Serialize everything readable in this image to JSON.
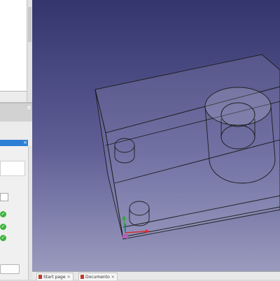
{
  "task_panel": {
    "close_glyph": "×",
    "checks": [
      "✓",
      "✓",
      "✓"
    ]
  },
  "tabs": [
    {
      "label": "Start page",
      "close": "×",
      "icon": "freecad-document-icon"
    },
    {
      "label": "Documento",
      "close": "×",
      "icon": "freecad-document-icon"
    }
  ],
  "colors": {
    "viewport_top": "#35356e",
    "viewport_bottom": "#9b9bbf",
    "task_header": "#2d7fd6",
    "check_ok": "#3cb43c",
    "model_edges": "#1c1c1c",
    "axis_x": "#d63030",
    "axis_y": "#30a830",
    "axis_z": "#3050d6"
  }
}
